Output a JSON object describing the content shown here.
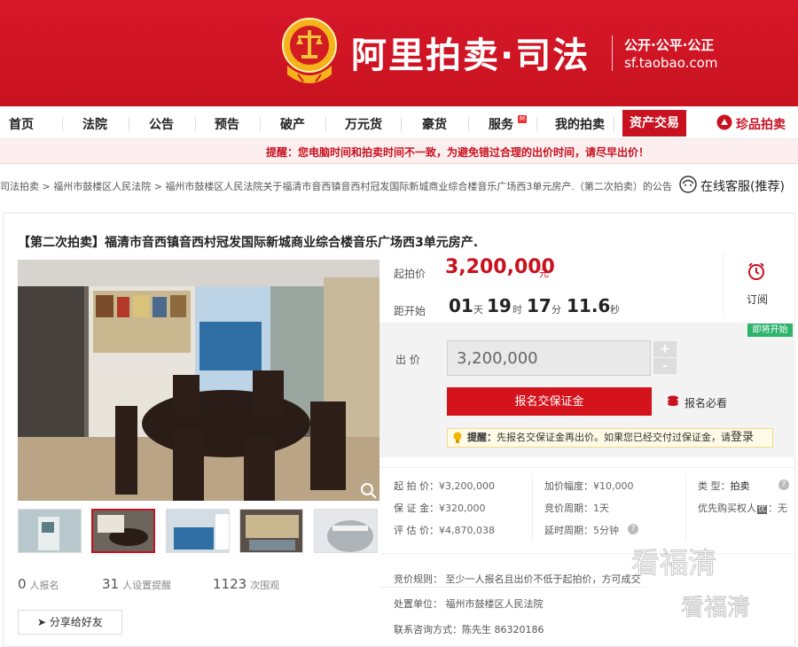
{
  "header": {
    "brand": "阿里拍卖·司法",
    "slogan": "公开·公平·公正",
    "domain": "sf.taobao.com"
  },
  "nav": {
    "items": [
      "首页",
      "法院",
      "公告",
      "预告",
      "破产",
      "万元货",
      "豪货",
      "服务",
      "我的拍卖"
    ],
    "badge": "M",
    "active": "资产交易",
    "right": "珍品拍卖"
  },
  "notice": "提醒：您电脑时间和拍卖时间不一致，为避免错过合理的出价时间，请尽早出价！",
  "breadcrumb": [
    "司法拍卖",
    "福州市鼓楼区人民法院",
    "福州市鼓楼区人民法院关于福清市音西镇音西村冠发国际新城商业综合楼音乐广场西3单元房产.（第二次拍卖）的公告"
  ],
  "service": "在线客服(推荐)",
  "title": "【第二次拍卖】福清市音西镇音西村冠发国际新城商业综合楼音乐广场西3单元房产.",
  "price": {
    "label": "起拍价",
    "value": "3,200,000",
    "unit": "元"
  },
  "countdown": {
    "label": "距开始",
    "days": "01",
    "days_unit": "天",
    "hours": "19",
    "hours_unit": "时",
    "minutes": "17",
    "minutes_unit": "分",
    "seconds": "11.6",
    "seconds_unit": "秒"
  },
  "subscribe": "订阅",
  "bid": {
    "tag": "即将开始",
    "label": "出  价",
    "value": "3,200,000",
    "plus": "+",
    "minus": "-",
    "signup": "报名交保证金",
    "must_read": "报名必看",
    "tip_label": "提醒：",
    "tip_text": "先报名交保证金再出价。如果您已经交付过保证金，请",
    "tip_link": "登录"
  },
  "details": {
    "start_price_label": "起 拍 价：",
    "start_price": "¥3,200,000",
    "deposit_label": "保 证 金：",
    "deposit": "¥320,000",
    "appraisal_label": "评 估 价：",
    "appraisal": "¥4,870,038",
    "increment_label": "加价幅度：",
    "increment": "¥10,000",
    "period_label": "竞价周期：",
    "period": "1天",
    "delay_label": "延时周期：",
    "delay": "5分钟",
    "type_label": "类     型：",
    "type": "拍卖",
    "priority_label": "优先购买权人",
    "priority_icon": "优",
    "priority": "：无"
  },
  "stats": {
    "signed": "0",
    "signed_label": "人报名",
    "reminders": "31",
    "reminders_label": "人设置提醒",
    "views": "1123",
    "views_label": "次围观"
  },
  "share": "分享给好友",
  "rules": "竞价规则：   至少一人报名且出价不低于起拍价，方可成交",
  "court": "处置单位：   福州市鼓楼区人民法院",
  "contact": "联系咨询方式：陈先生      86320186",
  "watermark": [
    "看福清",
    "看福清"
  ]
}
